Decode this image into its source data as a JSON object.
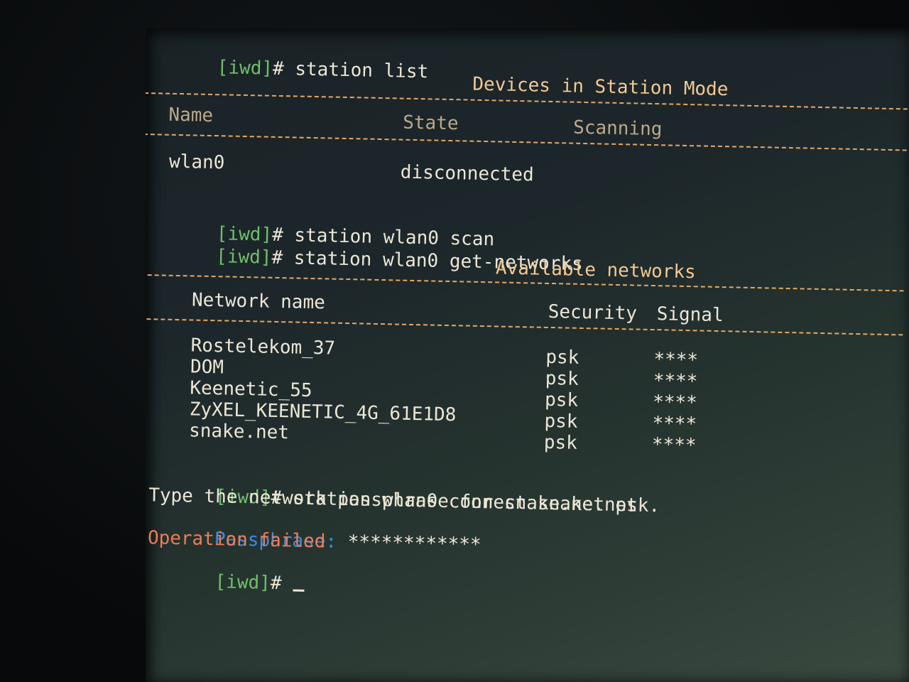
{
  "prompt": "[iwd]",
  "hash": "#",
  "cmd1": "station list",
  "station_table": {
    "title": "Devices in Station Mode",
    "headers": {
      "name": "Name",
      "state": "State",
      "scanning": "Scanning"
    },
    "rows": [
      {
        "name": "wlan0",
        "state": "disconnected",
        "scanning": ""
      }
    ]
  },
  "cmd2": "station wlan0 scan",
  "cmd3": "station wlan0 get-networks",
  "networks_table": {
    "title": "Available networks",
    "headers": {
      "name": "Network name",
      "security": "Security",
      "signal": "Signal"
    },
    "rows": [
      {
        "name": "Rostelekom_37",
        "security": "psk",
        "signal": "****"
      },
      {
        "name": "DOM",
        "security": "psk",
        "signal": "****"
      },
      {
        "name": "Keenetic_55",
        "security": "psk",
        "signal": "****"
      },
      {
        "name": "ZyXEL_KEENETIC_4G_61E1D8",
        "security": "psk",
        "signal": "****"
      },
      {
        "name": "snake.net",
        "security": "psk",
        "signal": "****"
      }
    ]
  },
  "cmd4": "station wlan0 connect snake.net",
  "passphrase_prompt": "Type the network passphrase for snake.net psk.",
  "passphrase_label": "Passphrase:",
  "passphrase_value": "************",
  "error": "Operation failed",
  "colors": {
    "prompt": "#6fbf6a",
    "text": "#ece6d6",
    "header": "#f3c893",
    "dash": "#e6a867",
    "passphrase": "#3c8de0",
    "error": "#ef7b57"
  }
}
